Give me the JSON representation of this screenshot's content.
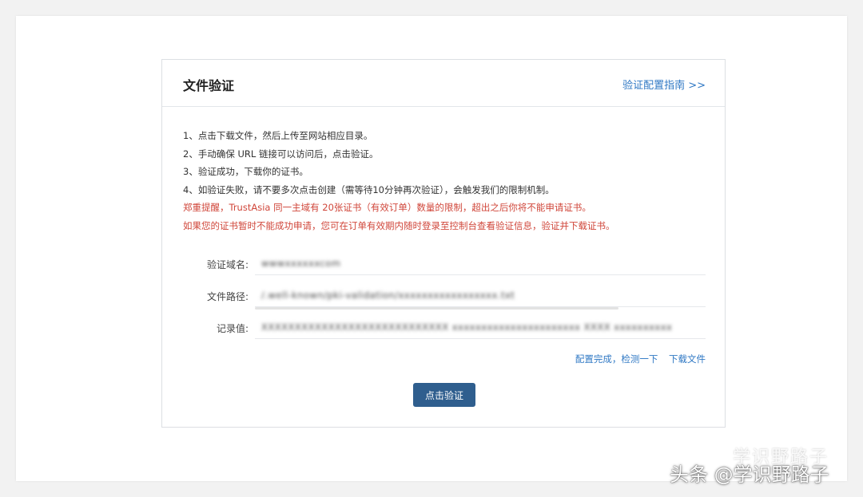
{
  "card": {
    "title": "文件验证",
    "guide_link": "验证配置指南 >>"
  },
  "instructions": {
    "steps": [
      "1、点击下载文件，然后上传至网站相应目录。",
      "2、手动确保 URL 链接可以访问后，点击验证。",
      "3、验证成功，下载你的证书。",
      "4、如验证失败，请不要多次点击创建（需等待10分钟再次验证），会触发我们的限制机制。"
    ],
    "warnings": [
      "郑重提醒，TrustAsia 同一主域有 20张证书（有效订单）数量的限制，超出之后你将不能申请证书。",
      "如果您的证书暂时不能成功申请，您可在订单有效期内随时登录至控制台查看验证信息，验证并下载证书。"
    ]
  },
  "fields": {
    "domain": {
      "label": "验证域名:",
      "value": "wwwxxxxxxcom"
    },
    "path": {
      "label": "文件路径:",
      "value": "/.well-known/pki-validation/xxxxxxxxxxxxxxxxx.txt"
    },
    "record": {
      "label": "记录值:",
      "value": "XXXXXXXXXXXXXXXXXXXXXXXXXXXX xxxxxxxxxxxxxxxxxxxxxx XXXX xxxxxxxxxx"
    }
  },
  "actions": {
    "configured_check": "配置完成，检测一下",
    "download_file": "下载文件"
  },
  "verify_button": "点击验证",
  "watermark": {
    "ghost": "学识野路子",
    "main": "头条 @学识野路子"
  },
  "colors": {
    "link": "#2f78c4",
    "warning": "#d0463a",
    "button": "#2f5e8e"
  }
}
